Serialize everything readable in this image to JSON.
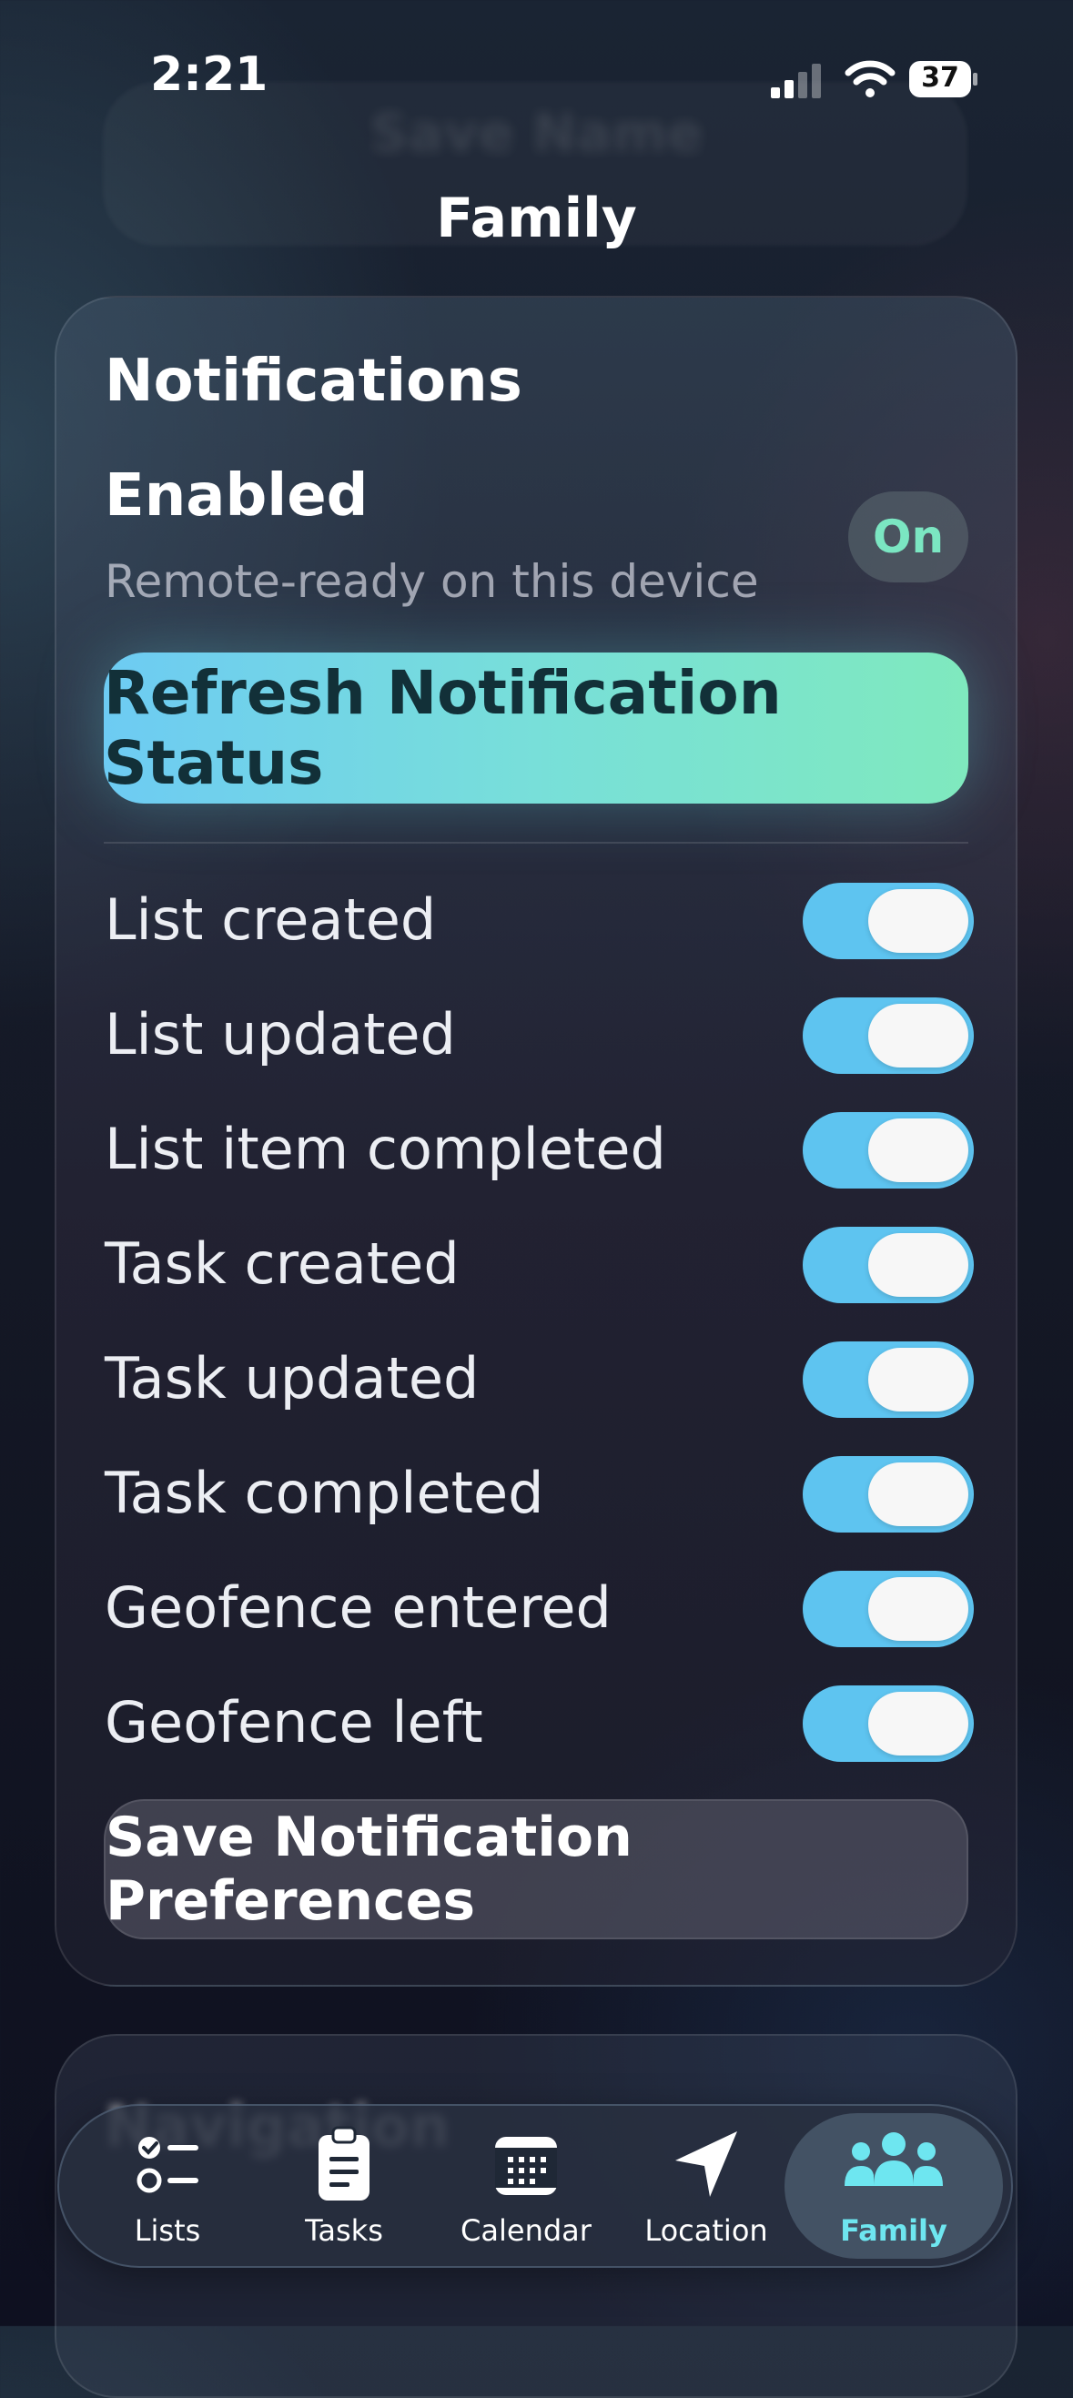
{
  "status_bar": {
    "time": "2:21",
    "battery": "37"
  },
  "ghost_header": "Save Name",
  "header": {
    "title": "Family"
  },
  "notifications": {
    "title": "Notifications",
    "status_title": "Enabled",
    "status_subtitle": "Remote-ready on this device",
    "status_badge": "On",
    "refresh_label": "Refresh Notification Status",
    "toggles": [
      {
        "label": "List created",
        "on": true
      },
      {
        "label": "List updated",
        "on": true
      },
      {
        "label": "List item completed",
        "on": true
      },
      {
        "label": "Task created",
        "on": true
      },
      {
        "label": "Task updated",
        "on": true
      },
      {
        "label": "Task completed",
        "on": true
      },
      {
        "label": "Geofence entered",
        "on": true
      },
      {
        "label": "Geofence left",
        "on": true
      }
    ],
    "save_label": "Save Notification Preferences"
  },
  "next_section_title": "Navigation",
  "tabs": [
    {
      "label": "Lists",
      "icon": "checklist-icon"
    },
    {
      "label": "Tasks",
      "icon": "clipboard-icon"
    },
    {
      "label": "Calendar",
      "icon": "calendar-icon"
    },
    {
      "label": "Location",
      "icon": "location-arrow-icon"
    },
    {
      "label": "Family",
      "icon": "people-icon",
      "active": true
    }
  ],
  "colors": {
    "accent": "#5ec4f0",
    "success": "#7be6c2",
    "active_tab": "#6ee6f0"
  }
}
